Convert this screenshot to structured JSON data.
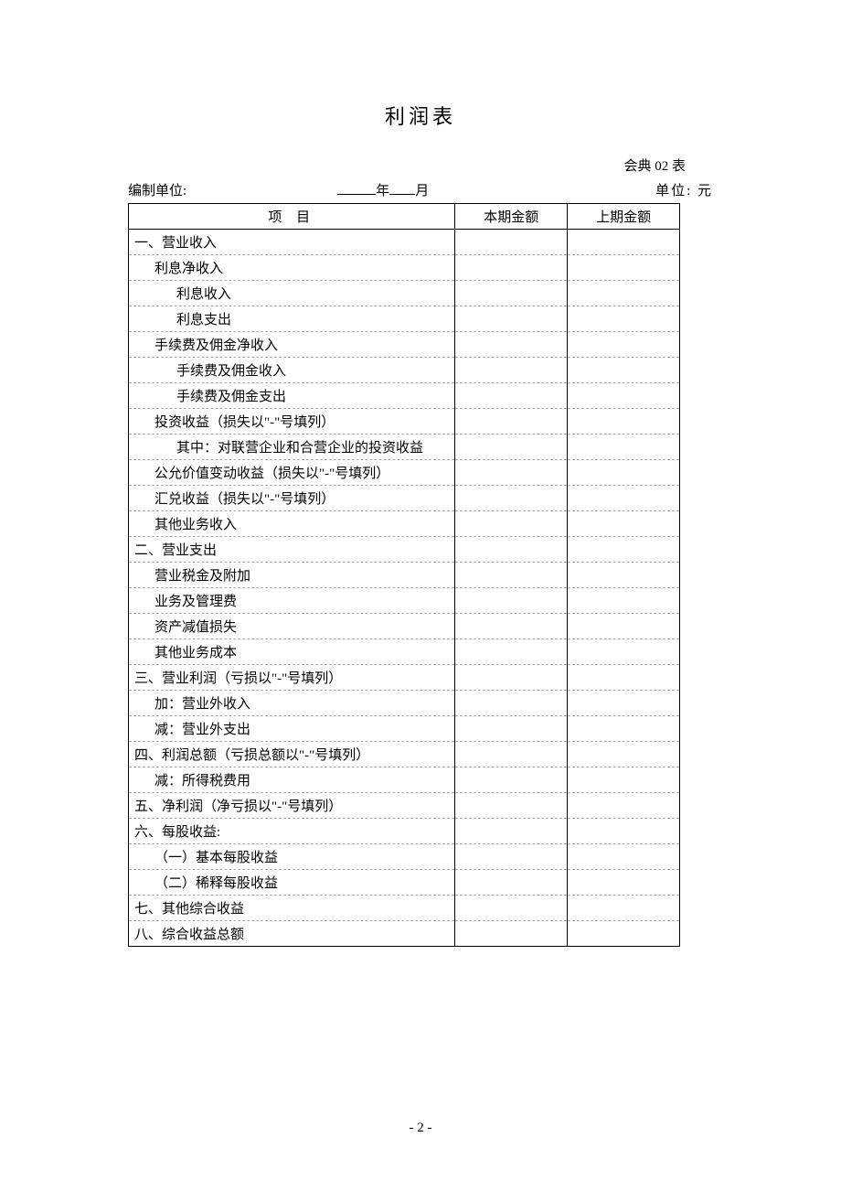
{
  "title": "利润表",
  "form_code": "会典 02 表",
  "header": {
    "org_label": "编制单位:",
    "year_suffix": "年",
    "month_suffix": "月",
    "unit_label": "单位:    元"
  },
  "columns": {
    "item": "项   目",
    "current": "本期金额",
    "prior": "上期金额"
  },
  "rows": [
    {
      "indent": 1,
      "label": "一、营业收入",
      "current": "",
      "prior": ""
    },
    {
      "indent": 2,
      "label": "利息净收入",
      "current": "",
      "prior": ""
    },
    {
      "indent": 3,
      "label": "利息收入",
      "current": "",
      "prior": ""
    },
    {
      "indent": 3,
      "label": "利息支出",
      "current": "",
      "prior": ""
    },
    {
      "indent": 2,
      "label": "手续费及佣金净收入",
      "current": "",
      "prior": ""
    },
    {
      "indent": 3,
      "label": "手续费及佣金收入",
      "current": "",
      "prior": ""
    },
    {
      "indent": 3,
      "label": "手续费及佣金支出",
      "current": "",
      "prior": ""
    },
    {
      "indent": 2,
      "label": "投资收益（损失以\"-\"号填列）",
      "current": "",
      "prior": ""
    },
    {
      "indent": 3,
      "label": "其中：对联营企业和合营企业的投资收益",
      "current": "",
      "prior": ""
    },
    {
      "indent": 2,
      "label": "公允价值变动收益（损失以\"-\"号填列）",
      "current": "",
      "prior": ""
    },
    {
      "indent": 2,
      "label": "汇兑收益（损失以\"-\"号填列）",
      "current": "",
      "prior": ""
    },
    {
      "indent": 2,
      "label": "其他业务收入",
      "current": "",
      "prior": ""
    },
    {
      "indent": 1,
      "label": "二、营业支出",
      "current": "",
      "prior": ""
    },
    {
      "indent": 2,
      "label": "营业税金及附加",
      "current": "",
      "prior": ""
    },
    {
      "indent": 2,
      "label": "业务及管理费",
      "current": "",
      "prior": ""
    },
    {
      "indent": 2,
      "label": "资产减值损失",
      "current": "",
      "prior": ""
    },
    {
      "indent": 2,
      "label": "其他业务成本",
      "current": "",
      "prior": ""
    },
    {
      "indent": 1,
      "label": "三、营业利润（亏损以\"-\"号填列）",
      "current": "",
      "prior": ""
    },
    {
      "indent": 2,
      "label": "加：营业外收入",
      "current": "",
      "prior": ""
    },
    {
      "indent": 2,
      "label": "减：营业外支出",
      "current": "",
      "prior": ""
    },
    {
      "indent": 1,
      "label": "四、利润总额（亏损总额以\"-\"号填列）",
      "current": "",
      "prior": ""
    },
    {
      "indent": 2,
      "label": "减：所得税费用",
      "current": "",
      "prior": ""
    },
    {
      "indent": 1,
      "label": "五、净利润（净亏损以\"-\"号填列）",
      "current": "",
      "prior": ""
    },
    {
      "indent": 1,
      "label": "六、每股收益:",
      "current": "",
      "prior": ""
    },
    {
      "indent": 2,
      "label": "（一）基本每股收益",
      "current": "",
      "prior": ""
    },
    {
      "indent": 2,
      "label": "（二）稀释每股收益",
      "current": "",
      "prior": ""
    },
    {
      "indent": 1,
      "label": "七、其他综合收益",
      "current": "",
      "prior": ""
    },
    {
      "indent": 1,
      "label": "八、综合收益总额",
      "current": "",
      "prior": ""
    }
  ],
  "page_number": "- 2 -"
}
